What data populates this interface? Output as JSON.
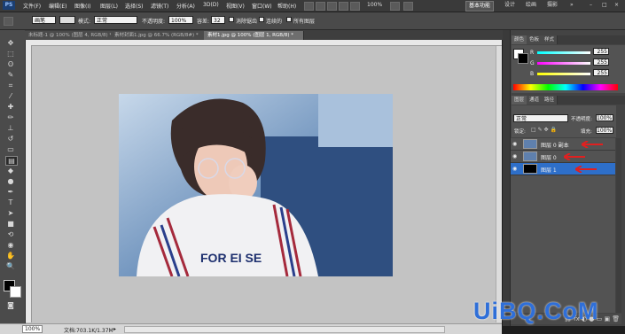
{
  "menubar": {
    "logo": "PS",
    "items": [
      "文件(F)",
      "编辑(E)",
      "图像(I)",
      "图层(L)",
      "选择(S)",
      "滤镜(T)",
      "分析(A)",
      "3D(D)",
      "视图(V)",
      "窗口(W)",
      "帮助(H)"
    ],
    "zoom": "100%",
    "workspaces": [
      "基本功能",
      "设计",
      "绘画",
      "摄影"
    ]
  },
  "options": {
    "tool_label": "画笔",
    "mode_label": "模式:",
    "mode_value": "正常",
    "opacity_label": "不透明度:",
    "opacity_value": "100%",
    "tolerance_label": "容差:",
    "tolerance_value": "32",
    "antialias_label": "消除锯齿",
    "contiguous_label": "连续的",
    "all_layers_label": "所有图层"
  },
  "tabs": [
    {
      "label": "未标题-1 @ 100% (图层 4, RGB/8) *",
      "active": false
    },
    {
      "label": "素材封面1.jpg @ 66.7% (RGB/8#) *",
      "active": false
    },
    {
      "label": "素材1.jpg @ 100% (图层 1, RGB/8) *",
      "active": true
    }
  ],
  "color_panel": {
    "tabs": [
      "颜色",
      "色板",
      "样式"
    ],
    "channels": [
      {
        "label": "R",
        "value": "255",
        "color": "#e03030"
      },
      {
        "label": "G",
        "value": "255",
        "color": "#30c030"
      },
      {
        "label": "B",
        "value": "255",
        "color": "#3050e0"
      }
    ]
  },
  "layers_panel": {
    "tabs": [
      "图层",
      "通道",
      "路径"
    ],
    "blend_mode": "正常",
    "opacity_label": "不透明度:",
    "opacity_value": "100%",
    "lock_label": "锁定:",
    "fill_label": "填充:",
    "fill_value": "100%",
    "layers": [
      {
        "name": "图层 0 副本",
        "selected": false
      },
      {
        "name": "图层 0",
        "selected": false
      },
      {
        "name": "图层 1",
        "selected": true
      }
    ]
  },
  "status": {
    "zoom": "100%",
    "doc_info": "文档:703.1K/1.37M"
  },
  "watermark": "UiBQ.CoM",
  "accent_color": "#2e6fc9"
}
